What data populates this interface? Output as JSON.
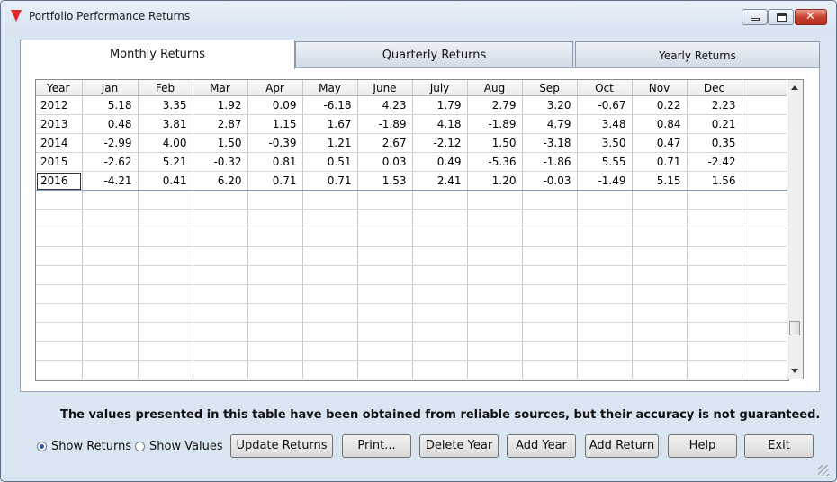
{
  "window": {
    "title": "Portfolio Performance Returns"
  },
  "tabs": [
    {
      "label": "Monthly Returns"
    },
    {
      "label": "Quarterly Returns"
    },
    {
      "label": "Yearly Returns"
    }
  ],
  "table": {
    "columns": [
      "Year",
      "Jan",
      "Feb",
      "Mar",
      "Apr",
      "May",
      "June",
      "July",
      "Aug",
      "Sep",
      "Oct",
      "Nov",
      "Dec"
    ],
    "rows": [
      [
        "2012",
        "5.18",
        "3.35",
        "1.92",
        "0.09",
        "-6.18",
        "4.23",
        "1.79",
        "2.79",
        "3.20",
        "-0.67",
        "0.22",
        "2.23"
      ],
      [
        "2013",
        "0.48",
        "3.81",
        "2.87",
        "1.15",
        "1.67",
        "-1.89",
        "4.18",
        "-1.89",
        "4.79",
        "3.48",
        "0.84",
        "0.21"
      ],
      [
        "2014",
        "-2.99",
        "4.00",
        "1.50",
        "-0.39",
        "1.21",
        "2.67",
        "-2.12",
        "1.50",
        "-3.18",
        "3.50",
        "0.47",
        "0.35"
      ],
      [
        "2015",
        "-2.62",
        "5.21",
        "-0.32",
        "0.81",
        "0.51",
        "0.03",
        "0.49",
        "-5.36",
        "-1.86",
        "5.55",
        "0.71",
        "-2.42"
      ],
      [
        "2016",
        "-4.21",
        "0.41",
        "6.20",
        "0.71",
        "0.71",
        "1.53",
        "2.41",
        "1.20",
        "-0.03",
        "-1.49",
        "5.15",
        "1.56"
      ]
    ],
    "selected_row": 4
  },
  "notice": "The values presented in this table have been obtained from reliable sources, but their accuracy is not guaranteed.",
  "radios": {
    "show_returns": "Show Returns",
    "show_values": "Show Values",
    "selected": "show_returns"
  },
  "buttons": {
    "update": "Update Returns",
    "print": "Print...",
    "delete_year": "Delete Year",
    "add_year": "Add Year",
    "add_return": "Add Return",
    "help": "Help",
    "exit": "Exit"
  },
  "colors": {
    "title_icon": "#e2262b",
    "close_button": "#c5432f"
  }
}
